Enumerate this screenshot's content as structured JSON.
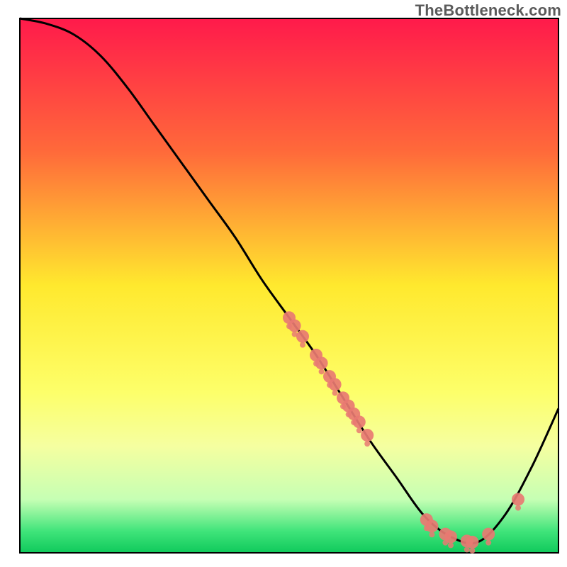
{
  "attribution": "TheBottleneck.com",
  "chart_data": {
    "type": "line",
    "title": "",
    "xlabel": "",
    "ylabel": "",
    "xlim": [
      0,
      100
    ],
    "ylim": [
      0,
      100
    ],
    "grid": false,
    "background_gradient": [
      {
        "stop": 0.0,
        "color": "#ff1a4b"
      },
      {
        "stop": 0.25,
        "color": "#ff6a3a"
      },
      {
        "stop": 0.5,
        "color": "#ffe92e"
      },
      {
        "stop": 0.7,
        "color": "#fdff6a"
      },
      {
        "stop": 0.8,
        "color": "#f5ffa0"
      },
      {
        "stop": 0.9,
        "color": "#c6ffb4"
      },
      {
        "stop": 0.96,
        "color": "#3fe47a"
      },
      {
        "stop": 1.0,
        "color": "#10c95c"
      }
    ],
    "series": [
      {
        "name": "bottleneck-curve",
        "color": "#000000",
        "x": [
          0,
          5,
          10,
          15,
          20,
          25,
          30,
          35,
          40,
          45,
          50,
          55,
          60,
          65,
          70,
          75,
          80,
          85,
          90,
          95,
          100
        ],
        "y": [
          100,
          99,
          97,
          93,
          87,
          80,
          73,
          66,
          59,
          51,
          44,
          37,
          29,
          21,
          14,
          7,
          3,
          2,
          7,
          16,
          27
        ]
      }
    ],
    "markers": {
      "name": "data-points",
      "color": "#e87a72",
      "radius_main": 9,
      "radius_tick": 4,
      "points": [
        {
          "x": 50.0,
          "y": 44.0
        },
        {
          "x": 51.0,
          "y": 42.5
        },
        {
          "x": 52.5,
          "y": 40.5
        },
        {
          "x": 55.0,
          "y": 37.0
        },
        {
          "x": 56.0,
          "y": 35.5
        },
        {
          "x": 57.5,
          "y": 33.0
        },
        {
          "x": 58.5,
          "y": 31.5
        },
        {
          "x": 60.0,
          "y": 29.0
        },
        {
          "x": 61.0,
          "y": 27.5
        },
        {
          "x": 62.0,
          "y": 26.0
        },
        {
          "x": 63.0,
          "y": 24.5
        },
        {
          "x": 64.5,
          "y": 22.0
        },
        {
          "x": 75.5,
          "y": 6.2
        },
        {
          "x": 76.5,
          "y": 5.0
        },
        {
          "x": 79.0,
          "y": 3.5
        },
        {
          "x": 80.0,
          "y": 3.0
        },
        {
          "x": 83.0,
          "y": 2.2
        },
        {
          "x": 84.0,
          "y": 2.0
        },
        {
          "x": 87.0,
          "y": 3.5
        },
        {
          "x": 92.5,
          "y": 10.0
        }
      ]
    }
  }
}
